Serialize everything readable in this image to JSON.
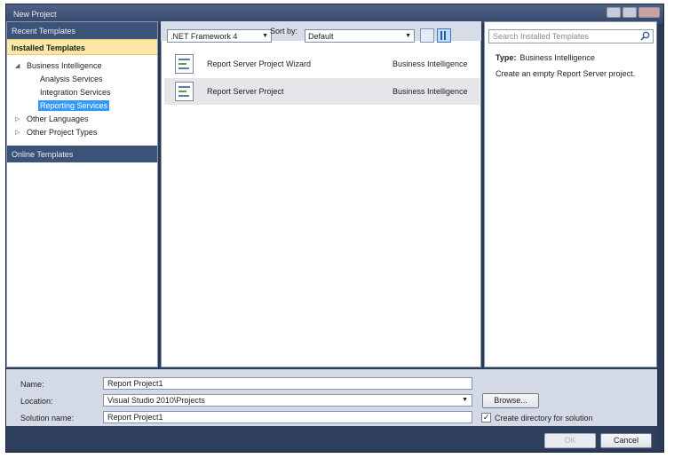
{
  "window": {
    "title": "New Project"
  },
  "left": {
    "recent": "Recent Templates",
    "installed": "Installed Templates",
    "tree": [
      {
        "label": "Business Intelligence",
        "expanded": true
      },
      {
        "label": "Analysis Services"
      },
      {
        "label": "Integration Services"
      },
      {
        "label": "Reporting Services",
        "selected": true
      },
      {
        "label": "Other Languages"
      },
      {
        "label": "Other Project Types"
      }
    ],
    "online": "Online Templates"
  },
  "toolbar": {
    "framework": ".NET Framework 4",
    "sort_label": "Sort by:",
    "sort_value": "Default"
  },
  "templates": [
    {
      "name": "Report Server Project Wizard",
      "category": "Business Intelligence"
    },
    {
      "name": "Report Server Project",
      "category": "Business Intelligence"
    }
  ],
  "details": {
    "search_placeholder": "Search Installed Templates",
    "type_label": "Type:",
    "type_value": "Business Intelligence",
    "description": "Create an empty Report Server project."
  },
  "form": {
    "name_label": "Name:",
    "name_value": "Report Project1",
    "location_label": "Location:",
    "location_value": "Visual Studio 2010\\Projects",
    "solution_label": "Solution name:",
    "solution_value": "Report Project1",
    "browse": "Browse...",
    "create_dir": "Create directory for solution",
    "check_mark": "✓"
  },
  "buttons": {
    "ok": "OK",
    "cancel": "Cancel"
  },
  "icons": [
    "minimize-icon",
    "maximize-icon",
    "close-icon",
    "expand-arrow-icon",
    "collapse-arrow-icon",
    "search-icon",
    "list-view-icon",
    "small-icons-view-icon",
    "report-wizard-icon",
    "report-project-icon",
    "dropdown-caret-icon"
  ]
}
